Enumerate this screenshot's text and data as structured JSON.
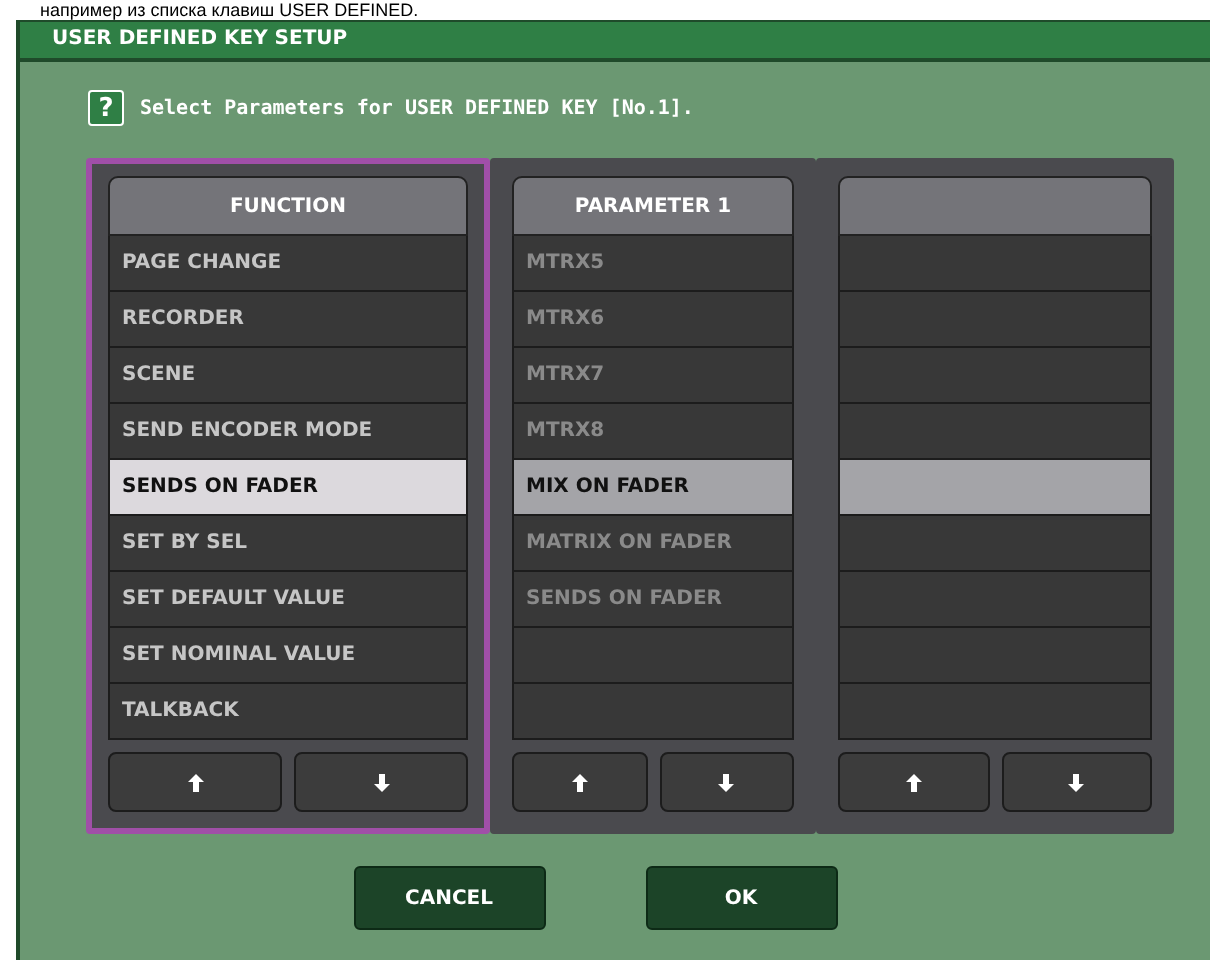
{
  "caption": "например из списка клавиш USER DEFINED.",
  "window": {
    "title": "USER DEFINED KEY SETUP"
  },
  "help": {
    "icon_text": "?",
    "message": "Select Parameters for USER DEFINED KEY [No.1]."
  },
  "columns": [
    {
      "header": "FUNCTION",
      "focused": true,
      "rows": [
        {
          "label": "PAGE CHANGE",
          "selected": false,
          "dimmed": false
        },
        {
          "label": "RECORDER",
          "selected": false,
          "dimmed": false
        },
        {
          "label": "SCENE",
          "selected": false,
          "dimmed": false
        },
        {
          "label": "SEND ENCODER MODE",
          "selected": false,
          "dimmed": false
        },
        {
          "label": "SENDS ON FADER",
          "selected": true,
          "dimmed": false
        },
        {
          "label": "SET BY SEL",
          "selected": false,
          "dimmed": false
        },
        {
          "label": "SET DEFAULT VALUE",
          "selected": false,
          "dimmed": false
        },
        {
          "label": "SET NOMINAL VALUE",
          "selected": false,
          "dimmed": false
        },
        {
          "label": "TALKBACK",
          "selected": false,
          "dimmed": false
        }
      ]
    },
    {
      "header": "PARAMETER 1",
      "focused": false,
      "rows": [
        {
          "label": "MTRX5",
          "selected": false,
          "dimmed": true
        },
        {
          "label": "MTRX6",
          "selected": false,
          "dimmed": true
        },
        {
          "label": "MTRX7",
          "selected": false,
          "dimmed": true
        },
        {
          "label": "MTRX8",
          "selected": false,
          "dimmed": true
        },
        {
          "label": "MIX ON FADER",
          "selected": true,
          "dimmed": false
        },
        {
          "label": "MATRIX ON FADER",
          "selected": false,
          "dimmed": true
        },
        {
          "label": "SENDS ON FADER",
          "selected": false,
          "dimmed": true
        },
        {
          "selected": false
        },
        {
          "selected": false
        }
      ]
    },
    {
      "focused": false,
      "rows": [
        {
          "selected": false
        },
        {
          "selected": false
        },
        {
          "selected": false
        },
        {
          "selected": false
        },
        {
          "selected": true
        },
        {
          "selected": false
        },
        {
          "selected": false
        },
        {
          "selected": false
        },
        {
          "selected": false
        }
      ]
    }
  ],
  "buttons": [
    {
      "label": "CANCEL"
    },
    {
      "label": "OK"
    }
  ]
}
